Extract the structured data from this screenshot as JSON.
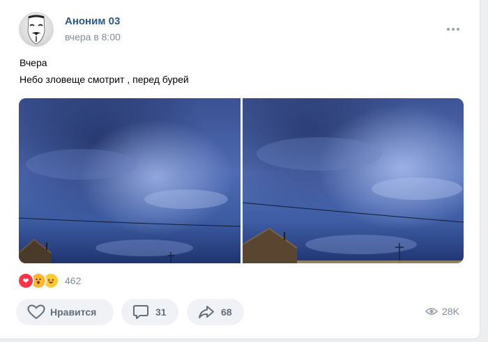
{
  "post": {
    "author": "Аноним 03",
    "time": "вчера в 8:00",
    "text_line1": "Вчера",
    "text_line2": "Небо зловеще смотрит , перед бурей"
  },
  "reactions": {
    "icons": [
      "heart-reaction",
      "surprised-reaction",
      "laughing-reaction"
    ],
    "count": "462"
  },
  "actions": {
    "like_label": "Нравится",
    "comments_count": "31",
    "shares_count": "68",
    "views": "28K"
  },
  "colors": {
    "author": "#2a5885",
    "secondary": "#818c99",
    "button_bg": "#f0f2f5",
    "button_text": "#626d7a",
    "heart": "#ff3347"
  }
}
